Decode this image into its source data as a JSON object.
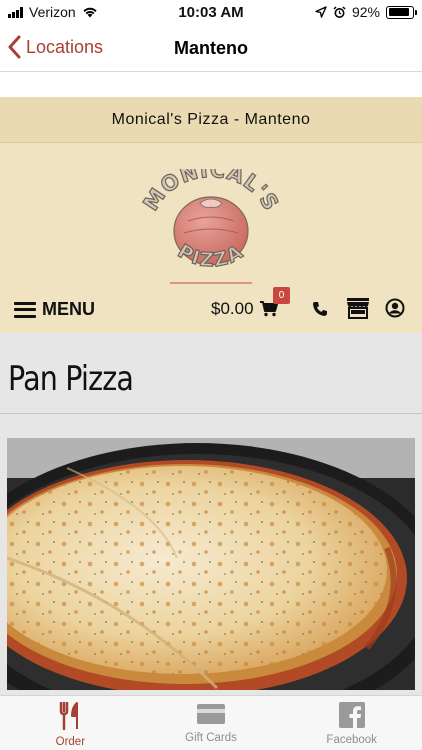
{
  "status_bar": {
    "carrier": "Verizon",
    "time": "10:03 AM",
    "battery": "92%"
  },
  "nav": {
    "back_label": "Locations",
    "title": "Manteno"
  },
  "header": {
    "restaurant_name": "Monical's Pizza - Manteno",
    "logo_text_top": "MONICAL'S",
    "logo_text_bottom": "PIZZA",
    "menu_label": "MENU",
    "cart_total": "$0.00",
    "cart_count": "0"
  },
  "content": {
    "section_title": "Pan Pizza"
  },
  "tabs": [
    {
      "label": "Order",
      "icon": "fork-knife-icon",
      "active": true
    },
    {
      "label": "Gift Cards",
      "icon": "gift-card-icon",
      "active": false
    },
    {
      "label": "Facebook",
      "icon": "facebook-icon",
      "active": false
    }
  ],
  "colors": {
    "accent": "#a64035",
    "header_bg": "#efe3c2",
    "badge": "#c9473e"
  }
}
